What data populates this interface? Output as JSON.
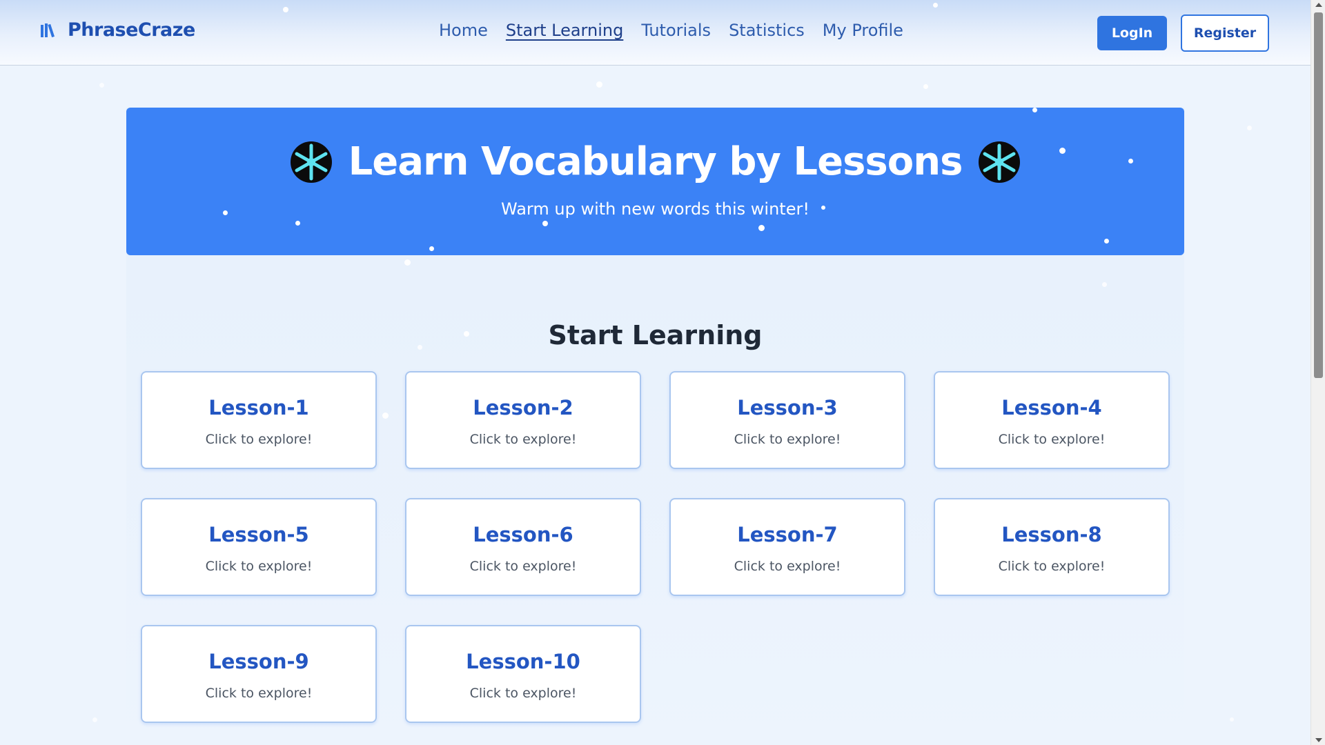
{
  "brand": {
    "name": "PhraseCraze",
    "icon": "books-icon"
  },
  "nav": {
    "links": [
      {
        "label": "Home",
        "active": false
      },
      {
        "label": "Start Learning",
        "active": true
      },
      {
        "label": "Tutorials",
        "active": false
      },
      {
        "label": "Statistics",
        "active": false
      },
      {
        "label": "My Profile",
        "active": false
      }
    ],
    "login_label": "LogIn",
    "register_label": "Register"
  },
  "hero": {
    "title": "Learn Vocabulary by Lessons",
    "subtitle": "Warm up with new words this winter!",
    "decor_icon": "snowflake-icon"
  },
  "section": {
    "title": "Start Learning"
  },
  "lessons": [
    {
      "title": "Lesson-1",
      "subtitle": "Click to explore!"
    },
    {
      "title": "Lesson-2",
      "subtitle": "Click to explore!"
    },
    {
      "title": "Lesson-3",
      "subtitle": "Click to explore!"
    },
    {
      "title": "Lesson-4",
      "subtitle": "Click to explore!"
    },
    {
      "title": "Lesson-5",
      "subtitle": "Click to explore!"
    },
    {
      "title": "Lesson-6",
      "subtitle": "Click to explore!"
    },
    {
      "title": "Lesson-7",
      "subtitle": "Click to explore!"
    },
    {
      "title": "Lesson-8",
      "subtitle": "Click to explore!"
    },
    {
      "title": "Lesson-9",
      "subtitle": "Click to explore!"
    },
    {
      "title": "Lesson-10",
      "subtitle": "Click to explore!"
    }
  ],
  "colors": {
    "accent": "#3b82f6",
    "brand": "#1e4fb0",
    "lesson_title": "#2356c2",
    "page_bg": "#edf4fd"
  }
}
